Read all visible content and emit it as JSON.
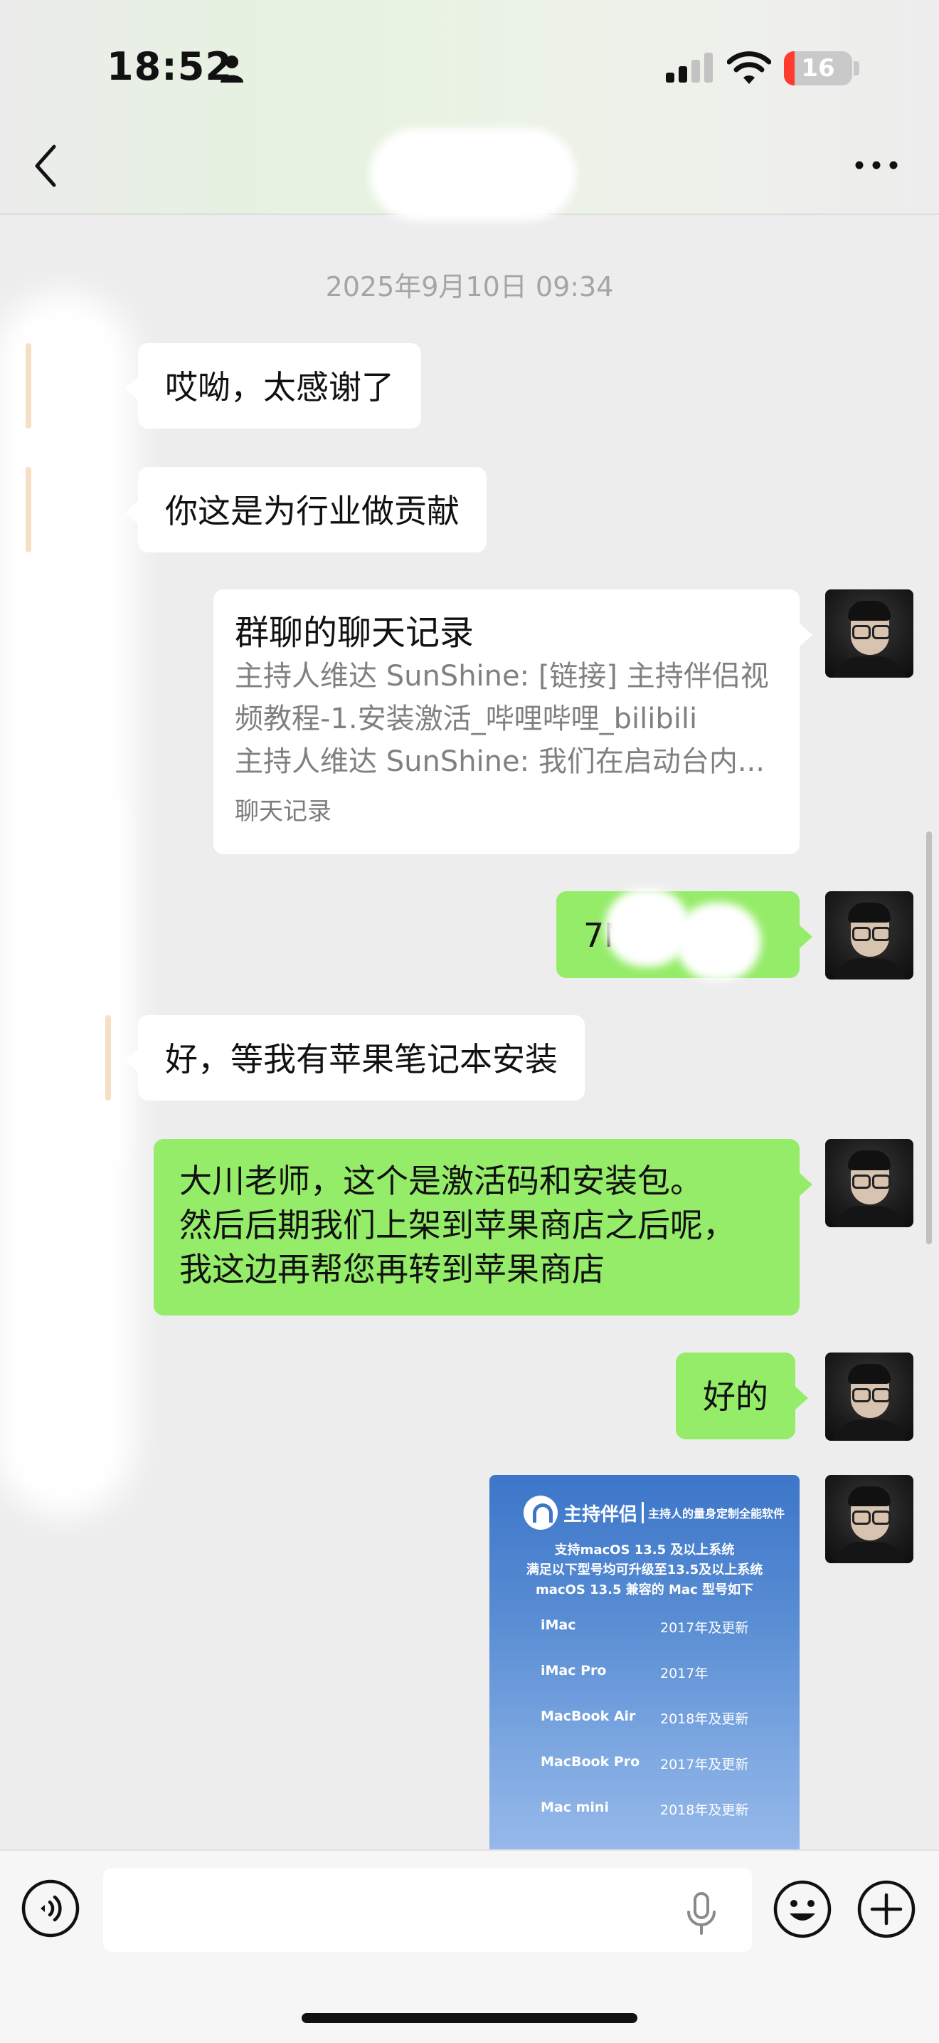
{
  "status_bar": {
    "time": "18:52",
    "battery": "16"
  },
  "chat": {
    "timestamp": "2025年9月10日 09:34",
    "messages": [
      {
        "side": "in",
        "text": "哎呦，太感谢了"
      },
      {
        "side": "in",
        "text": "你这是为行业做贡献"
      },
      {
        "side": "out",
        "type": "chat-record",
        "title": "群聊的聊天记录",
        "lines": [
          "主持人维达 SunShine: [链接] 主持伴侣视",
          "频教程-1.安装激活_哔哩哔哩_bilibili",
          "主持人维达 SunShine: 我们在启动台内..."
        ],
        "footer": "聊天记录"
      },
      {
        "side": "out",
        "text": "7N      D"
      },
      {
        "side": "in",
        "text": "好，等我有苹果笔记本安装"
      },
      {
        "side": "out",
        "lines": [
          "大川老师，这个是激活码和安装包。",
          "然后后期我们上架到苹果商店之后呢，",
          "我这边再帮您再转到苹果商店"
        ]
      },
      {
        "side": "out",
        "text": "好的"
      },
      {
        "side": "out",
        "type": "image",
        "brand": "主持伴侣",
        "slogan": "主持人的量身定制全能软件",
        "subtitle": [
          "支持macOS 13.5 及以上系统",
          "满足以下型号均可升级至13.5及以上系统",
          "macOS 13.5 兼容的 Mac 型号如下"
        ],
        "rows": [
          {
            "model": "iMac",
            "year": "2017年及更新"
          },
          {
            "model": "iMac Pro",
            "year": "2017年"
          },
          {
            "model": "MacBook Air",
            "year": "2018年及更新"
          },
          {
            "model": "MacBook Pro",
            "year": "2017年及更新"
          },
          {
            "model": "Mac mini",
            "year": "2018年及更新"
          }
        ]
      }
    ]
  },
  "input": {
    "placeholder": ""
  },
  "colors": {
    "outgoing_bubble": "#95ec69",
    "incoming_bubble": "#ffffff",
    "background": "#ededed"
  },
  "icons": [
    "person-icon",
    "signal-icon",
    "wifi-icon",
    "back-icon",
    "more-icon",
    "voice-icon",
    "mic-icon",
    "emoji-icon",
    "plus-icon"
  ]
}
